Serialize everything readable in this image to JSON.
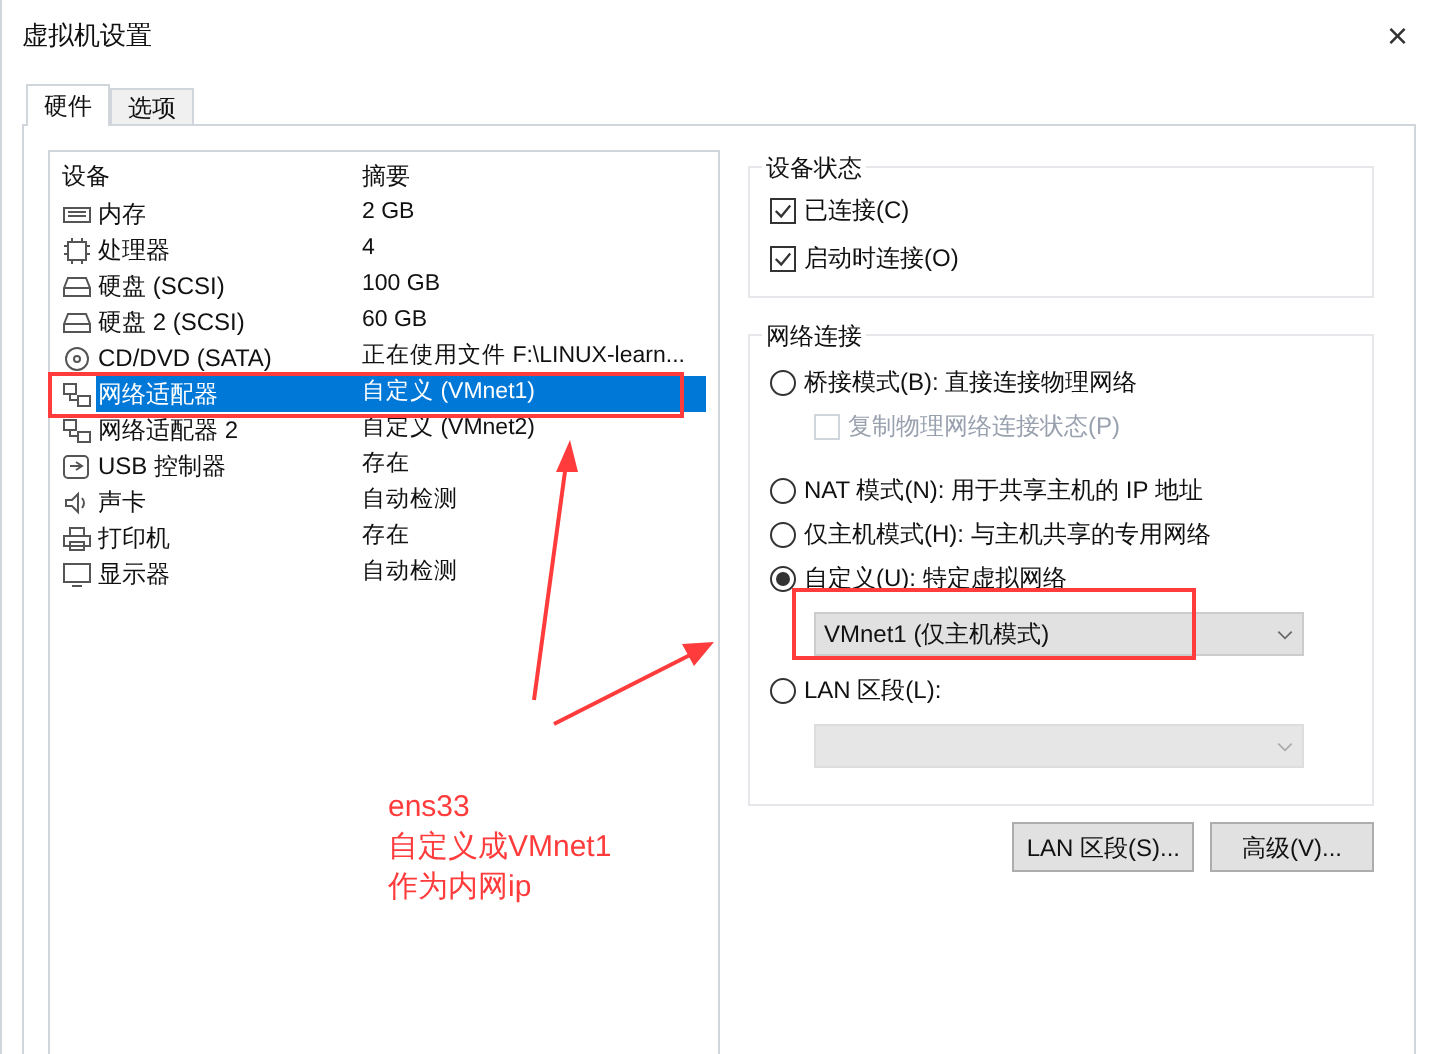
{
  "window": {
    "title": "虚拟机设置",
    "close": "×"
  },
  "tabs": [
    {
      "label": "硬件",
      "selected": true
    },
    {
      "label": "选项",
      "selected": false
    }
  ],
  "device_table": {
    "columns": [
      "设备",
      "摘要"
    ],
    "rows": [
      {
        "device": "内存",
        "summary": "2 GB",
        "selected": false
      },
      {
        "device": "处理器",
        "summary": "4",
        "selected": false
      },
      {
        "device": "硬盘 (SCSI)",
        "summary": "100 GB",
        "selected": false
      },
      {
        "device": "硬盘 2 (SCSI)",
        "summary": "60 GB",
        "selected": false
      },
      {
        "device": "CD/DVD (SATA)",
        "summary": "正在使用文件 F:\\LINUX-learn...",
        "selected": false
      },
      {
        "device": "网络适配器",
        "summary": "自定义 (VMnet1)",
        "selected": true
      },
      {
        "device": "网络适配器 2",
        "summary": "自定义 (VMnet2)",
        "selected": false
      },
      {
        "device": "USB 控制器",
        "summary": "存在",
        "selected": false
      },
      {
        "device": "声卡",
        "summary": "自动检测",
        "selected": false
      },
      {
        "device": "打印机",
        "summary": "存在",
        "selected": false
      },
      {
        "device": "显示器",
        "summary": "自动检测",
        "selected": false
      }
    ]
  },
  "device_status": {
    "title": "设备状态",
    "options": [
      {
        "label": "已连接(C)",
        "checked": true
      },
      {
        "label": "启动时连接(O)",
        "checked": true
      }
    ]
  },
  "network_connection": {
    "title": "网络连接",
    "options": [
      {
        "kind": "radio",
        "label": "桥接模式(B): 直接连接物理网络",
        "selected": false,
        "disabled": false
      },
      {
        "kind": "checkbox",
        "label": "复制物理网络连接状态(P)",
        "checked": false,
        "disabled": true
      },
      {
        "kind": "radio",
        "label": "NAT 模式(N): 用于共享主机的 IP 地址",
        "selected": false,
        "disabled": false
      },
      {
        "kind": "radio",
        "label": "仅主机模式(H): 与主机共享的专用网络",
        "selected": false,
        "disabled": false
      },
      {
        "kind": "radio",
        "label": "自定义(U): 特定虚拟网络",
        "selected": true,
        "disabled": false
      },
      {
        "kind": "dropdown",
        "value": "VMnet1 (仅主机模式)",
        "disabled": false
      },
      {
        "kind": "radio",
        "label": "LAN 区段(L):",
        "selected": false,
        "disabled": false
      },
      {
        "kind": "dropdown",
        "disabled": true
      }
    ]
  },
  "buttons": [
    "LAN 区段(S)...",
    "高级(V)..."
  ],
  "annotation": {
    "lines": [
      "ens33",
      "自定义成VMnet1",
      "作为内网ip"
    ]
  }
}
